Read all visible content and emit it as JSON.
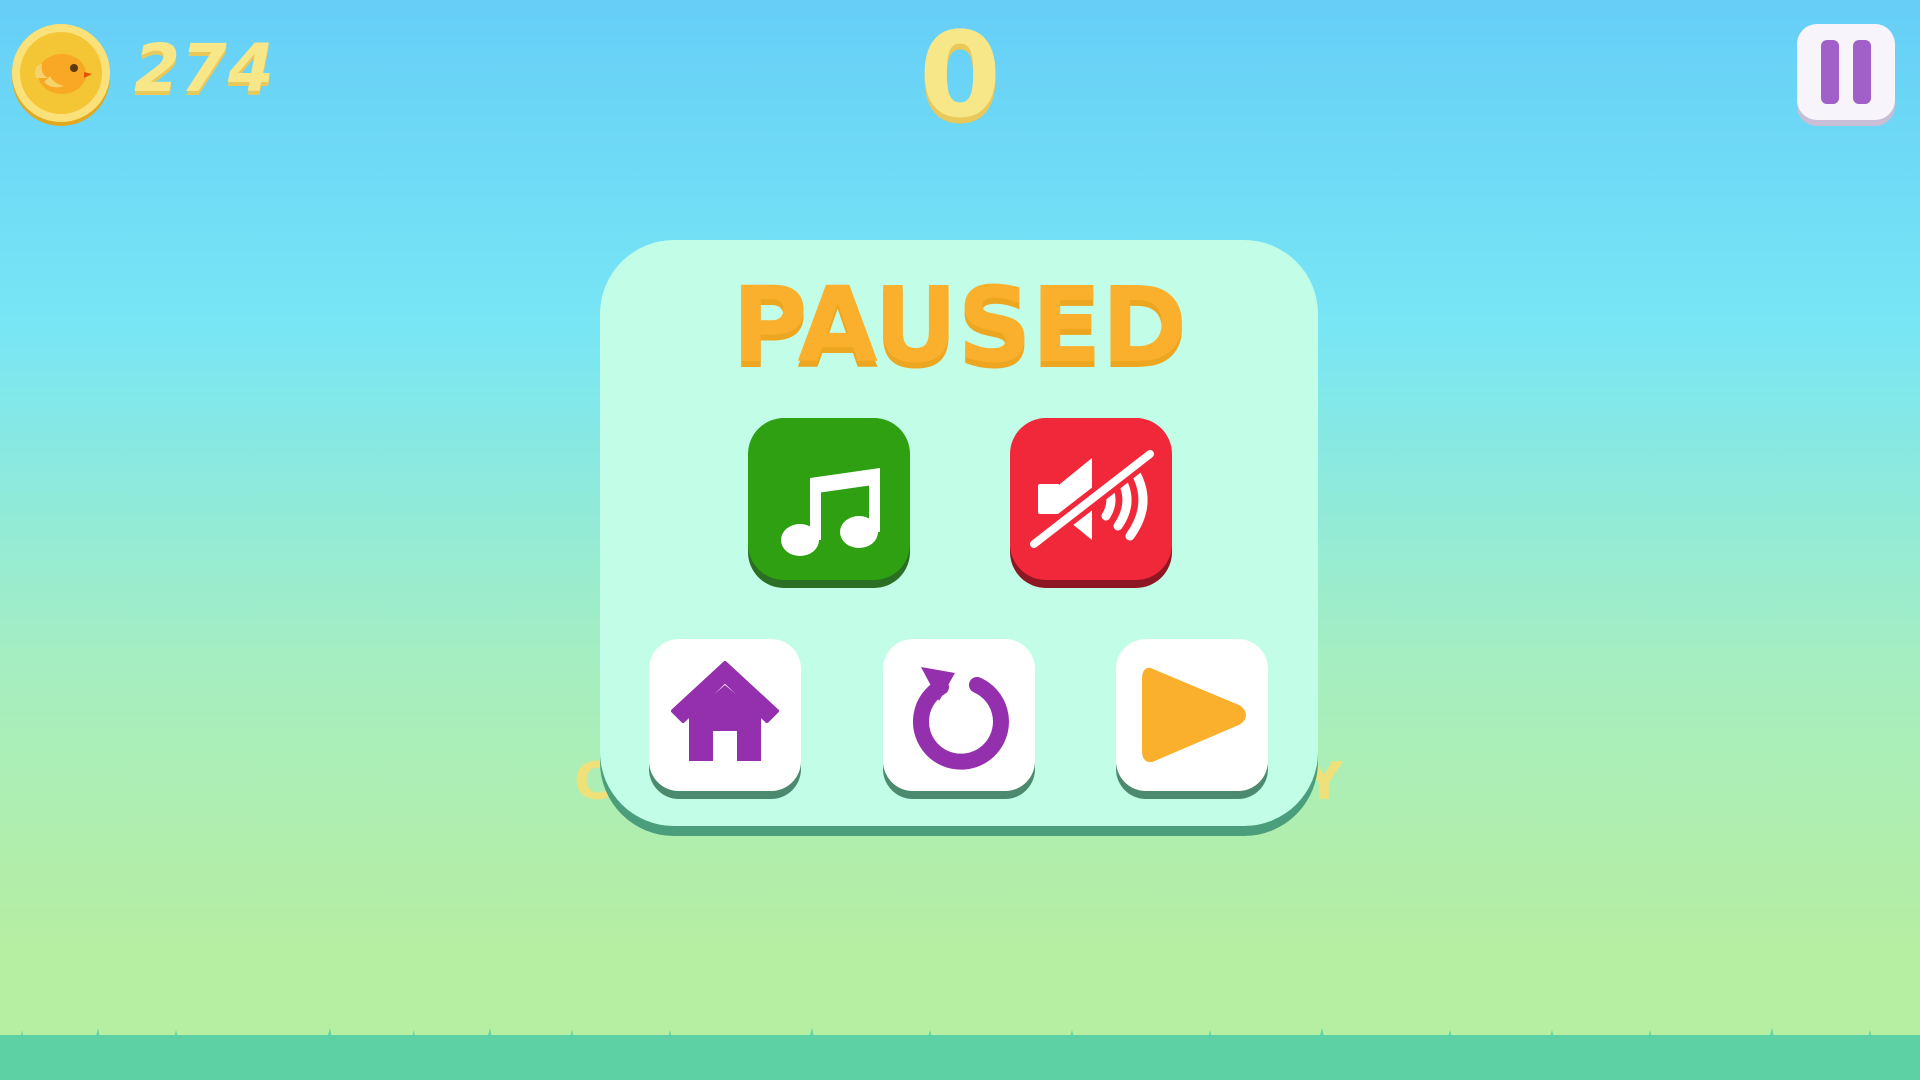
{
  "hud": {
    "coin_count": "274",
    "score": "0",
    "coin_icon": "coin-bird-icon",
    "pause_icon": "pause-icon"
  },
  "background_hint": {
    "left": "C",
    "right": "Y"
  },
  "pause_menu": {
    "title": "PAUSED",
    "buttons": [
      {
        "name": "music",
        "icon": "music-note-icon",
        "color": "#2ea012"
      },
      {
        "name": "sound",
        "icon": "sound-muted-icon",
        "color": "#f1283a"
      },
      {
        "name": "home",
        "icon": "home-icon",
        "color": "#9430ad"
      },
      {
        "name": "restart",
        "icon": "restart-icon",
        "color": "#9430ad"
      },
      {
        "name": "resume",
        "icon": "play-icon",
        "color": "#fbb02d"
      }
    ]
  },
  "colors": {
    "title": "#fbb02d",
    "panel": "#c2fde7",
    "hud_text": "#f8e788",
    "pause_bars": "#a060c8"
  }
}
